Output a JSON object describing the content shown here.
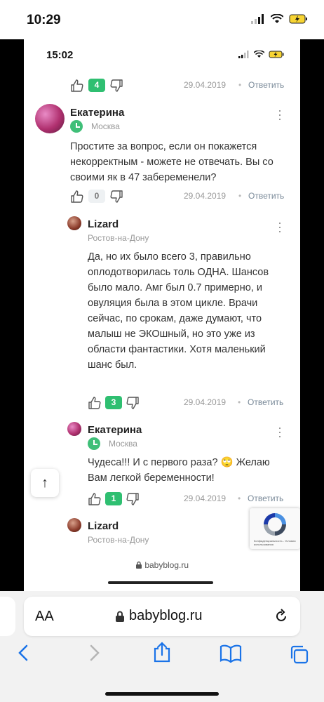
{
  "outer_status": {
    "time": "10:29",
    "battery_icon": "battery-charging-icon"
  },
  "inner_status": {
    "time": "15:02"
  },
  "comments": [
    {
      "likes": "4",
      "date": "29.04.2019",
      "sep": "•",
      "reply": "Ответить"
    },
    {
      "name": "Екатерина",
      "city": "Москва",
      "text": "Простите за вопрос, если он покажется некорректным - можете не отвечать. Вы со своими як в 47 забеременели?",
      "likes": "0",
      "date": "29.04.2019",
      "sep": "•",
      "reply": "Ответить"
    },
    {
      "name": "Lizard",
      "city": "Ростов-на-Дону",
      "text": "Да, но их было всего 3, правильно оплодотворилась толь ОДНА. Шансов было мало. Амг был 0.7 примерно, и овуляция была в этом цикле. Врачи сейчас, по срокам, даже думают, что малыш не ЭКОшный, но это уже из области фантастики. Хотя маленький шанс был.",
      "likes": "3",
      "date": "29.04.2019",
      "sep": "•",
      "reply": "Ответить"
    },
    {
      "name": "Екатерина",
      "city": "Москва",
      "text": "Чудеса!!! И с первого раза? 🙄 Желаю Вам легкой беременности!",
      "likes": "1",
      "date": "29.04.2019",
      "sep": "•",
      "reply": "Ответить"
    },
    {
      "name": "Lizard",
      "city": "Ростов-на-Дону"
    }
  ],
  "scroll_top_glyph": "↑",
  "captcha": {
    "label": "Конфиденциальность - Условия использования"
  },
  "inner_url": "babyblog.ru",
  "safari": {
    "aa": "AA",
    "url": "babyblog.ru"
  },
  "colors": {
    "accent_green": "#2fbf71",
    "link": "#7a8a99",
    "ios_blue": "#1a73e8"
  }
}
